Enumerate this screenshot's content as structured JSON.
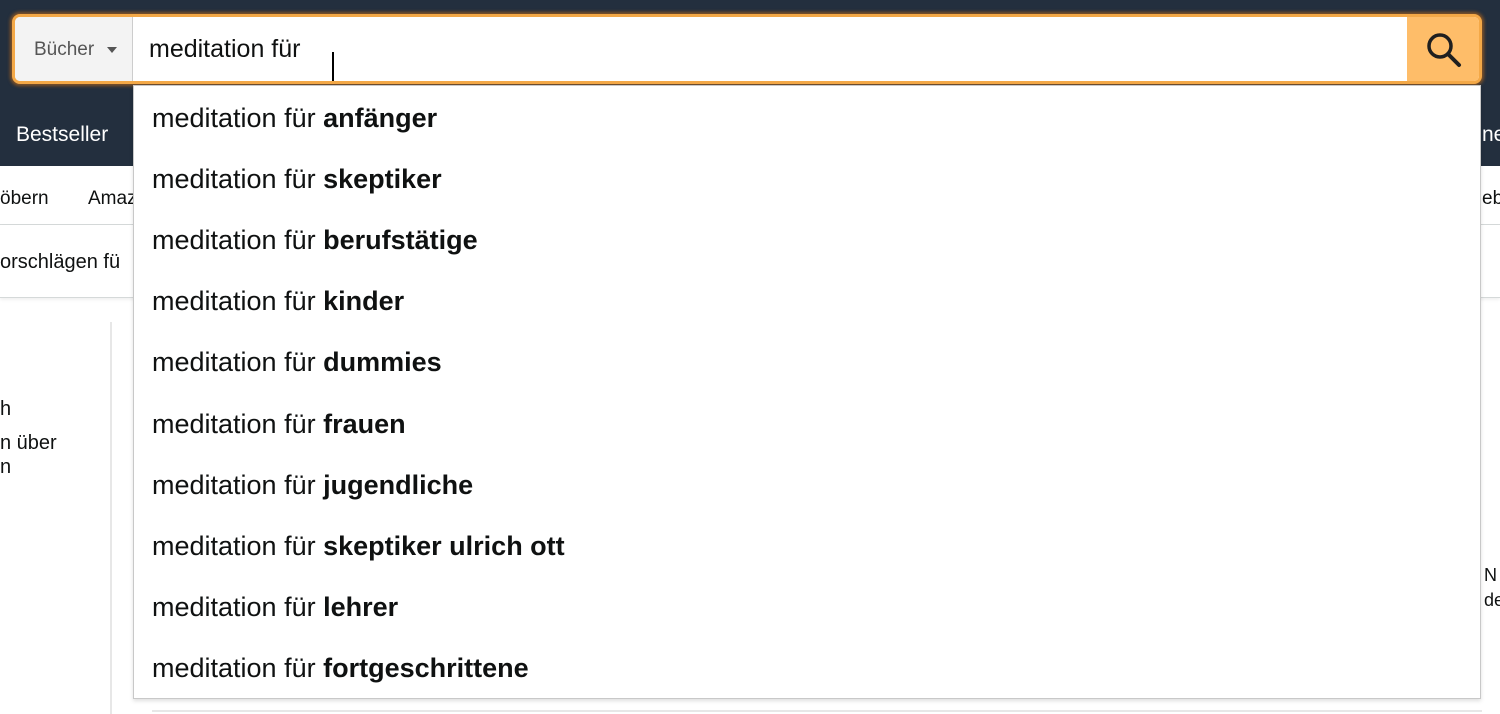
{
  "search": {
    "category": "Bücher",
    "query": "meditation für"
  },
  "nav": {
    "bestseller": "Bestseller",
    "right_fragment": "ne"
  },
  "subnav": {
    "item1": "öbern",
    "item2": "Amaz",
    "right_fragment": "ebo"
  },
  "banner": {
    "text": "orschlägen fü"
  },
  "left_panel": {
    "line1": "h",
    "line2": "n über",
    "line3": "n"
  },
  "right_panel": {
    "line1": "N",
    "line2": "de"
  },
  "suggestions": [
    {
      "prefix": "meditation für ",
      "completion": "anfänger"
    },
    {
      "prefix": "meditation für ",
      "completion": "skeptiker"
    },
    {
      "prefix": "meditation für ",
      "completion": "berufstätige"
    },
    {
      "prefix": "meditation für ",
      "completion": "kinder"
    },
    {
      "prefix": "meditation für ",
      "completion": "dummies"
    },
    {
      "prefix": "meditation für ",
      "completion": "frauen"
    },
    {
      "prefix": "meditation für ",
      "completion": "jugendliche"
    },
    {
      "prefix": "meditation für ",
      "completion": "skeptiker ulrich ott"
    },
    {
      "prefix": "meditation für ",
      "completion": "lehrer"
    },
    {
      "prefix": "meditation für ",
      "completion": "fortgeschrittene"
    }
  ],
  "colors": {
    "header_bg": "#232f3e",
    "search_border": "#f3a847",
    "search_button": "#febd69"
  },
  "icons": {
    "search_button": "magnifier-icon",
    "category": "caret-down-icon"
  }
}
